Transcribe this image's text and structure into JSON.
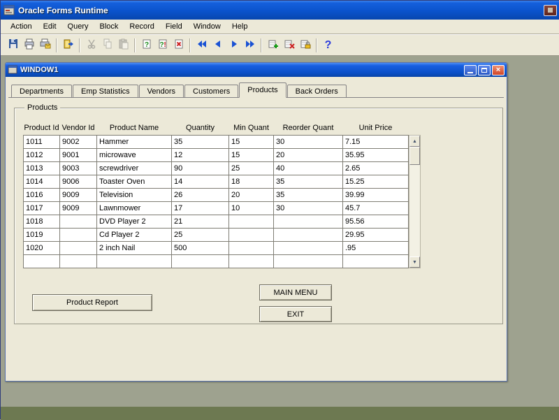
{
  "app": {
    "title": "Oracle Forms Runtime"
  },
  "menu": {
    "items": [
      "Action",
      "Edit",
      "Query",
      "Block",
      "Record",
      "Field",
      "Window",
      "Help"
    ]
  },
  "toolbar": {
    "icons": [
      "save-icon",
      "print-icon",
      "print-report-icon",
      "exit-icon",
      "cut-icon",
      "copy-icon",
      "paste-icon",
      "enter-query-icon",
      "execute-query-icon",
      "cancel-query-icon",
      "first-record-icon",
      "previous-record-icon",
      "next-record-icon",
      "last-record-icon",
      "insert-record-icon",
      "delete-record-icon",
      "lock-record-icon",
      "help-icon"
    ]
  },
  "inner_window": {
    "title": "WINDOW1"
  },
  "tabs": {
    "items": [
      "Departments",
      "Emp Statistics",
      "Vendors",
      "Customers",
      "Products",
      "Back Orders"
    ],
    "active": "Products"
  },
  "group_label": "Products",
  "table": {
    "headers": [
      "Product Id",
      "Vendor Id",
      "Product Name",
      "Quantity",
      "Min Quant",
      "Reorder Quant",
      "Unit Price"
    ],
    "rows": [
      [
        "1011",
        "9002",
        "Hammer",
        "35",
        "15",
        "30",
        "7.15"
      ],
      [
        "1012",
        "9001",
        "microwave",
        "12",
        "15",
        "20",
        "35.95"
      ],
      [
        "1013",
        "9003",
        "screwdriver",
        "90",
        "25",
        "40",
        "2.65"
      ],
      [
        "1014",
        "9006",
        "Toaster Oven",
        "14",
        "18",
        "35",
        "15.25"
      ],
      [
        "1016",
        "9009",
        "Television",
        "26",
        "20",
        "35",
        "39.99"
      ],
      [
        "1017",
        "9009",
        "Lawnmower",
        "17",
        "10",
        "30",
        "45.7"
      ],
      [
        "1018",
        "",
        "DVD Player 2",
        "21",
        "",
        "",
        "95.56"
      ],
      [
        "1019",
        "",
        "Cd Player 2",
        "25",
        "",
        "",
        "29.95"
      ],
      [
        "1020",
        "",
        "2 inch Nail",
        "500",
        "",
        "",
        ".95"
      ],
      [
        "",
        "",
        "",
        "",
        "",
        "",
        ""
      ]
    ]
  },
  "buttons": {
    "product_report": "Product Report",
    "main_menu": "MAIN MENU",
    "exit": "EXIT"
  },
  "glyphs": {
    "close": "×",
    "help": "?",
    "scroll_up": "▲",
    "scroll_down": "▼"
  },
  "colors": {
    "titlebar_blue": "#0b53cc",
    "mdi_background": "#9ea28f",
    "form_background": "#ece9d8",
    "close_red": "#cf4527",
    "cell_background": "#ffffff",
    "bottom_strip": "#6d7951"
  }
}
